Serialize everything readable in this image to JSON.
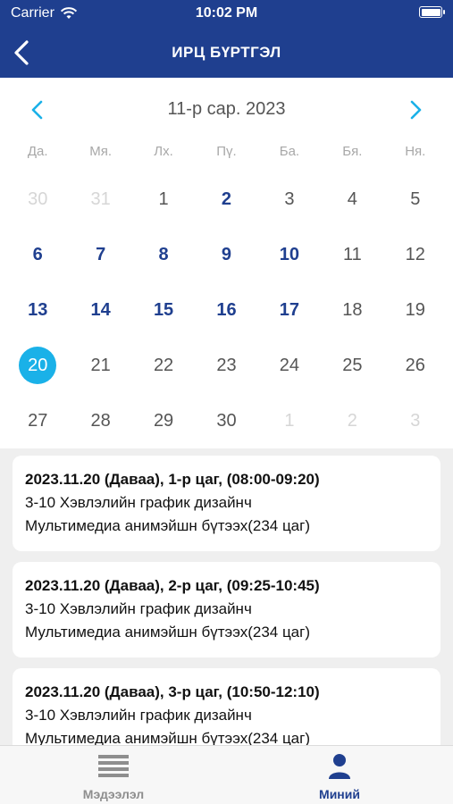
{
  "status": {
    "carrier": "Carrier",
    "time": "10:02 PM"
  },
  "header": {
    "title": "ИРЦ БҮРТГЭЛ"
  },
  "calendar": {
    "month_label": "11-р сар. 2023",
    "weekdays": [
      "Да.",
      "Мя.",
      "Лх.",
      "Пү.",
      "Ба.",
      "Бя.",
      "Ня."
    ],
    "weeks": [
      [
        [
          "30",
          "muted"
        ],
        [
          "31",
          "muted"
        ],
        [
          "1",
          "normal"
        ],
        [
          "2",
          "bold"
        ],
        [
          "3",
          "normal"
        ],
        [
          "4",
          "normal"
        ],
        [
          "5",
          "normal"
        ]
      ],
      [
        [
          "6",
          "bold"
        ],
        [
          "7",
          "bold"
        ],
        [
          "8",
          "bold"
        ],
        [
          "9",
          "bold"
        ],
        [
          "10",
          "bold"
        ],
        [
          "11",
          "normal"
        ],
        [
          "12",
          "normal"
        ]
      ],
      [
        [
          "13",
          "bold"
        ],
        [
          "14",
          "bold"
        ],
        [
          "15",
          "bold"
        ],
        [
          "16",
          "bold"
        ],
        [
          "17",
          "bold"
        ],
        [
          "18",
          "normal"
        ],
        [
          "19",
          "normal"
        ]
      ],
      [
        [
          "20",
          "selected"
        ],
        [
          "21",
          "normal"
        ],
        [
          "22",
          "normal"
        ],
        [
          "23",
          "normal"
        ],
        [
          "24",
          "normal"
        ],
        [
          "25",
          "normal"
        ],
        [
          "26",
          "normal"
        ]
      ],
      [
        [
          "27",
          "normal"
        ],
        [
          "28",
          "normal"
        ],
        [
          "29",
          "normal"
        ],
        [
          "30",
          "normal"
        ],
        [
          "1",
          "muted"
        ],
        [
          "2",
          "muted"
        ],
        [
          "3",
          "muted"
        ]
      ]
    ]
  },
  "sessions": [
    {
      "line1": "2023.11.20 (Даваа), 1-р цаг, (08:00-09:20)",
      "line2": "3-10 Хэвлэлийн график дизайнч",
      "line3": "Мультимедиа анимэйшн бүтээх(234 цаг)"
    },
    {
      "line1": "2023.11.20 (Даваа), 2-р цаг, (09:25-10:45)",
      "line2": "3-10 Хэвлэлийн график дизайнч",
      "line3": "Мультимедиа анимэйшн бүтээх(234 цаг)"
    },
    {
      "line1": "2023.11.20 (Даваа), 3-р цаг, (10:50-12:10)",
      "line2": "3-10 Хэвлэлийн график дизайнч",
      "line3": "Мультимедиа анимэйшн бүтээх(234 цаг)"
    }
  ],
  "tabs": {
    "info": "Мэдээлэл",
    "mine": "Миний"
  },
  "colors": {
    "header": "#1f3f8f",
    "selected_day": "#1ab1e8",
    "active_tab": "#1f3f8f"
  }
}
